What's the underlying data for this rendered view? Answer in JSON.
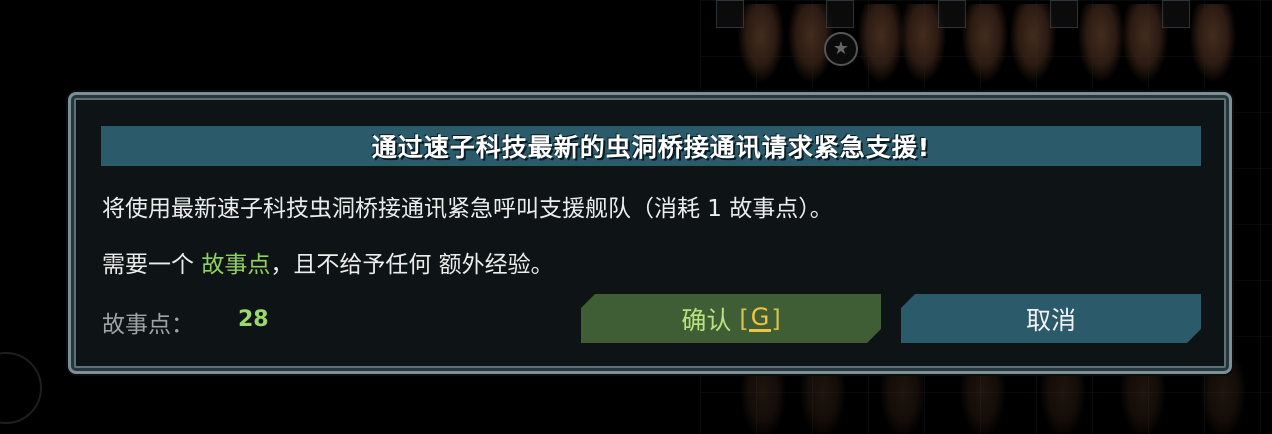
{
  "dialog": {
    "title": "通过速子科技最新的虫洞桥接通讯请求紧急支援!",
    "line1": "将使用最新速子科技虫洞桥接通讯紧急呼叫支援舰队（消耗 1 故事点）。",
    "line2_prefix": "需要一个 ",
    "line2_highlight": "故事点",
    "line2_suffix": "，且不给予任何 额外经验。",
    "story_points_label": "故事点：",
    "story_points_value": "28"
  },
  "buttons": {
    "confirm_label": "确认",
    "confirm_hotkey_open": "[",
    "confirm_hotkey_key": "G",
    "confirm_hotkey_close": "]",
    "cancel_label": "取消"
  },
  "background": {
    "star_icon": "★"
  },
  "colors": {
    "title_bar": "#2b5a6a",
    "confirm_button": "#405e35",
    "cancel_button": "#2b5a6a",
    "highlight_green": "#8fd35c",
    "hotkey_yellow": "#f0c43c"
  }
}
